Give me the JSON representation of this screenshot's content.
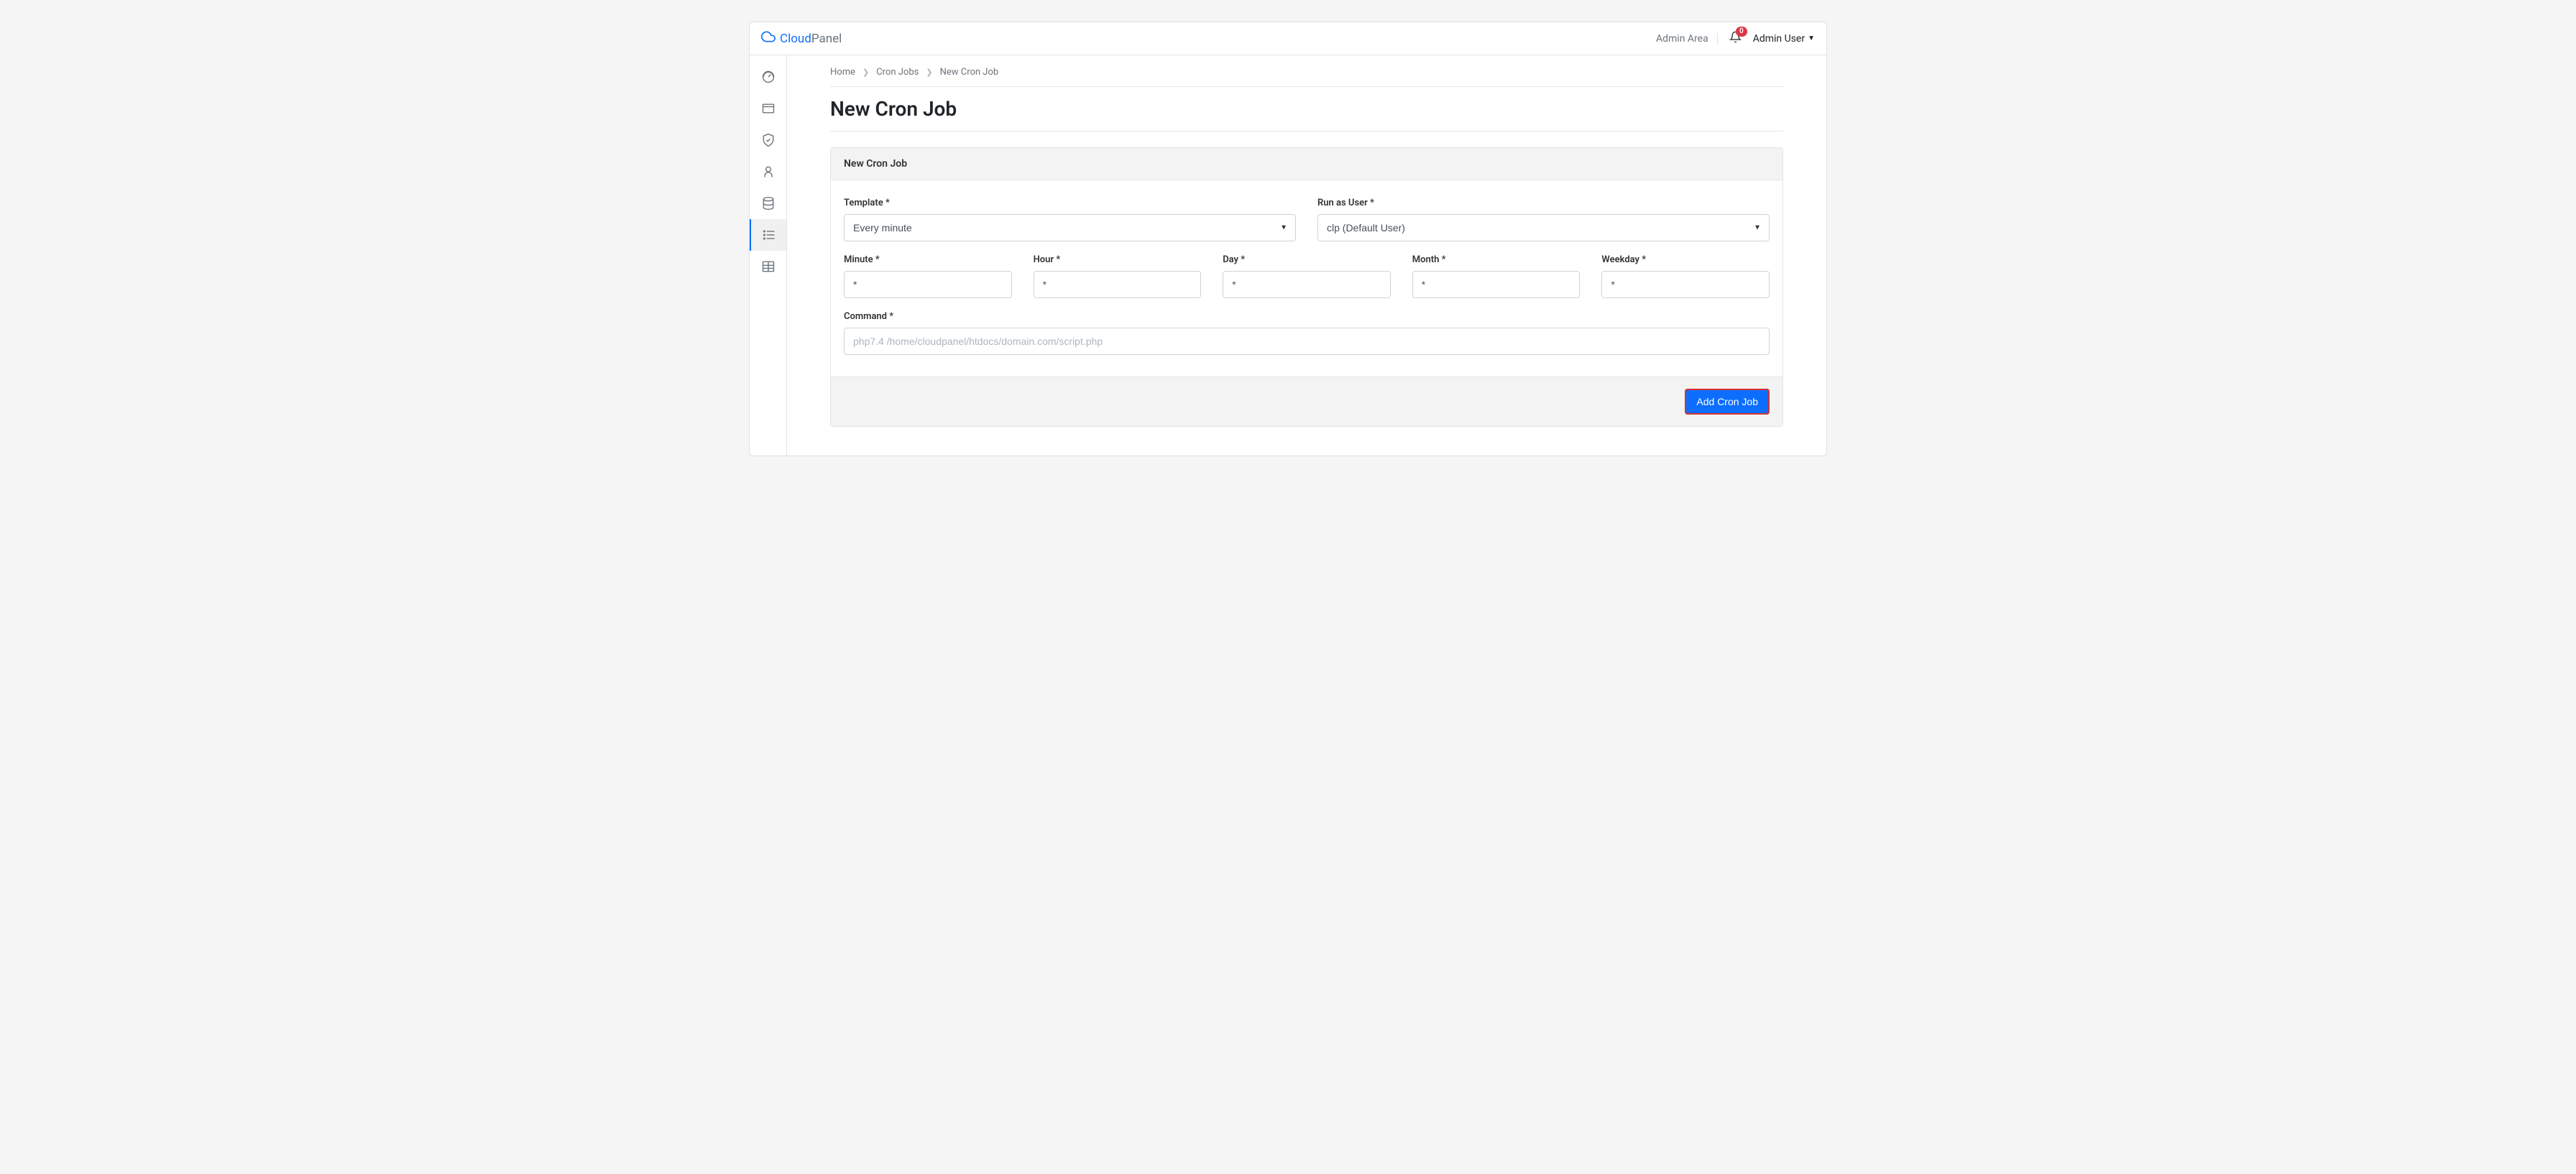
{
  "header": {
    "logo": {
      "cloud": "Cloud",
      "panel": "Panel"
    },
    "admin_area": "Admin Area",
    "notification_count": "0",
    "user": "Admin User"
  },
  "breadcrumbs": {
    "home": "Home",
    "cron_jobs": "Cron Jobs",
    "new_cron_job": "New Cron Job"
  },
  "page_title": "New Cron Job",
  "card": {
    "title": "New Cron Job",
    "labels": {
      "template": "Template *",
      "run_as_user": "Run as User *",
      "minute": "Minute *",
      "hour": "Hour *",
      "day": "Day *",
      "month": "Month *",
      "weekday": "Weekday *",
      "command": "Command *"
    },
    "values": {
      "template": "Every minute",
      "run_as_user": "clp (Default User)",
      "minute": "*",
      "hour": "*",
      "day": "*",
      "month": "*",
      "weekday": "*",
      "command_placeholder": "php7.4 /home/cloudpanel/htdocs/domain.com/script.php"
    },
    "button": "Add Cron Job"
  }
}
